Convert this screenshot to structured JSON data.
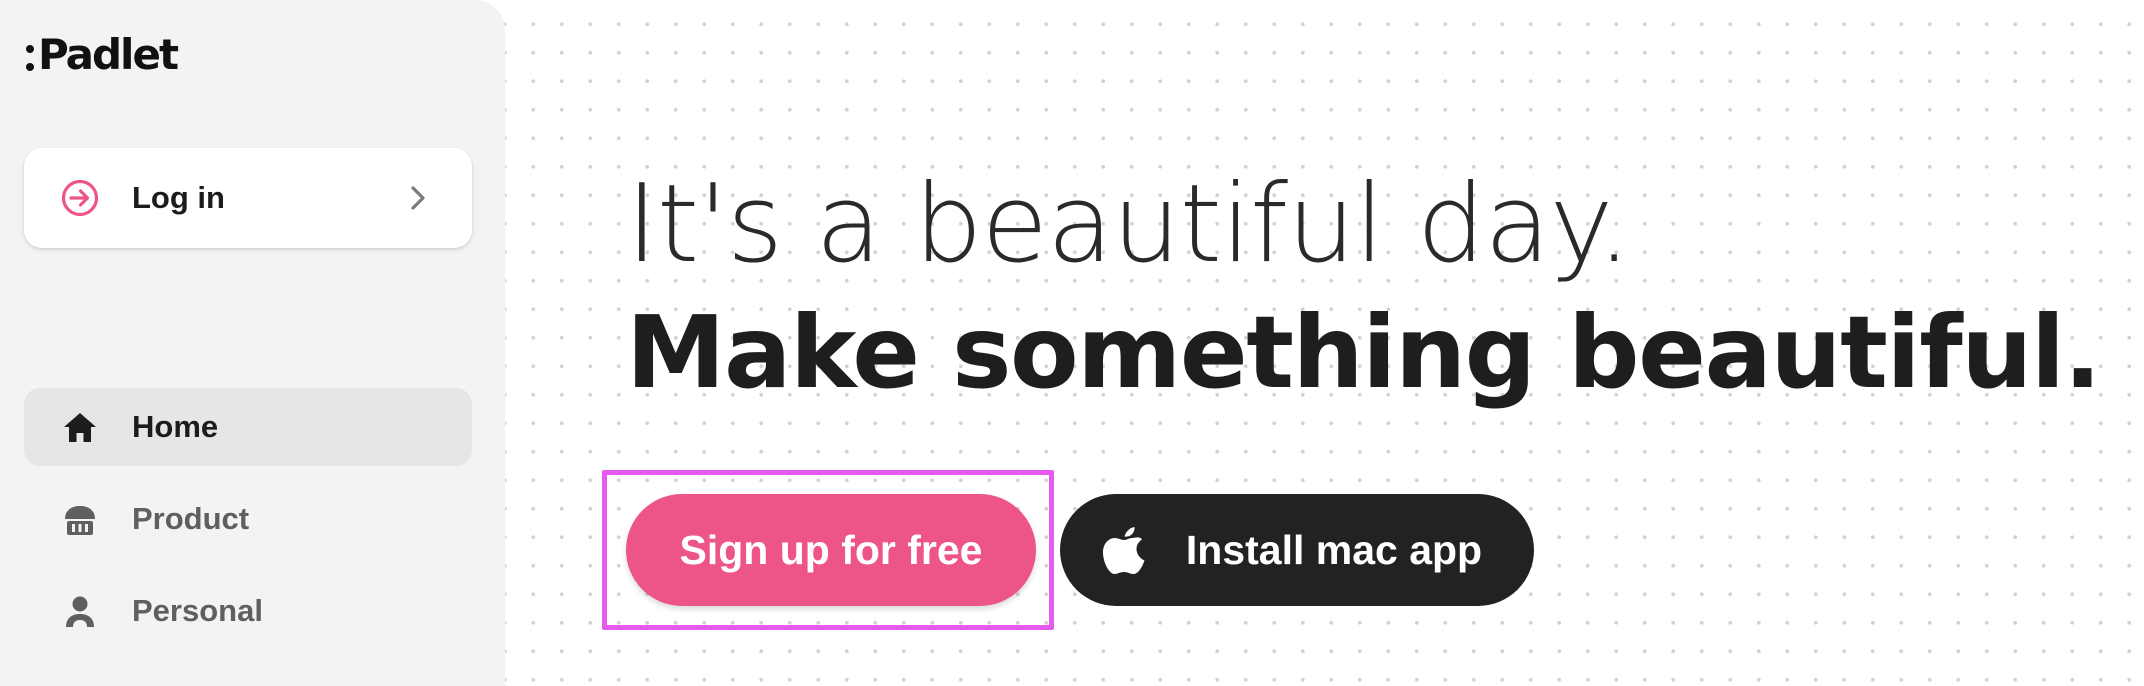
{
  "sidebar": {
    "logo_text": "Padlet",
    "login": {
      "label": "Log in",
      "icon": "arrow-right-circle-icon",
      "chevron": "chevron-right-icon"
    },
    "nav_items": [
      {
        "label": "Home",
        "icon": "home-icon",
        "active": true
      },
      {
        "label": "Product",
        "icon": "cupcake-icon",
        "active": false
      },
      {
        "label": "Personal",
        "icon": "person-icon",
        "active": false
      }
    ]
  },
  "hero": {
    "headline_line1": "It's a beautiful day.",
    "headline_line2": "Make something beautiful.",
    "signup_button": "Sign up for free",
    "mac_button": "Install mac app",
    "mac_icon": "apple-icon"
  },
  "colors": {
    "accent_pink": "#ec5585",
    "dark_button": "#222222",
    "highlight_outline": "#e75af0",
    "sidebar_bg": "#f3f3f3",
    "active_nav_bg": "#e6e6e6"
  }
}
